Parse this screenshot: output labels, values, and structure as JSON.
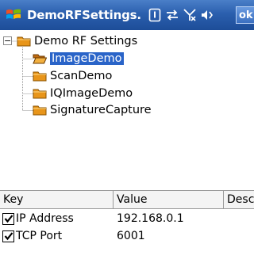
{
  "titlebar": {
    "title": "DemoRFSettings.",
    "ok_label": "ok",
    "icons": [
      "windows-start-icon",
      "notification-icon",
      "connectivity-icon",
      "signal-off-icon",
      "volume-icon"
    ]
  },
  "tree": {
    "expander": "−",
    "root": "Demo RF Settings",
    "children": [
      "ImageDemo",
      "ScanDemo",
      "IQImageDemo",
      "SignatureCapture"
    ],
    "selected_index": 0
  },
  "grid": {
    "columns": [
      "Key",
      "Value",
      "Desc"
    ],
    "rows": [
      {
        "checked": true,
        "key": "IP Address",
        "value": "192.168.0.1"
      },
      {
        "checked": true,
        "key": "TCP Port",
        "value": "6001"
      }
    ]
  },
  "colors": {
    "titlebar": "#2b5fae",
    "selection": "#2a64c8",
    "folder": "#e8951a"
  }
}
